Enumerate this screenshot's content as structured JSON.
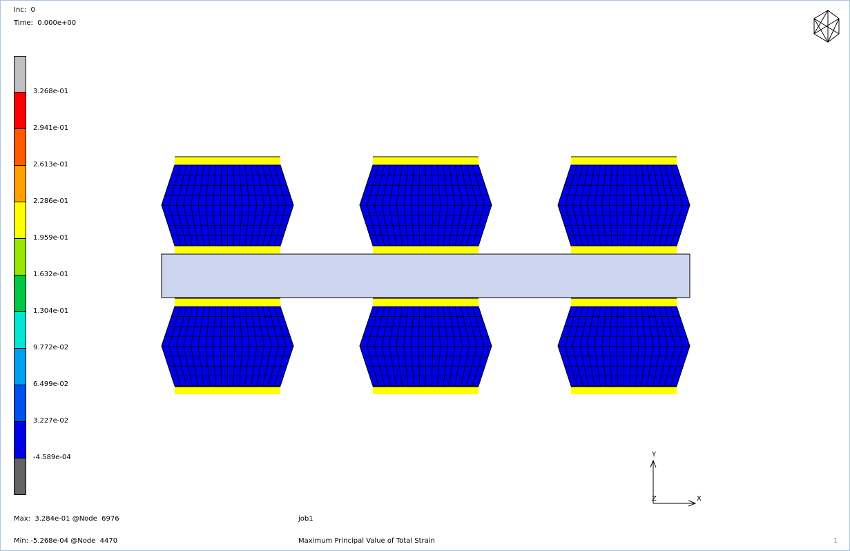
{
  "header": {
    "inc_label": "Inc:",
    "inc_value": "0",
    "time_label": "Time:",
    "time_value": "0.000e+00"
  },
  "legend": {
    "colors": [
      "#c0c0c0",
      "#ff0000",
      "#ff5a00",
      "#ffa000",
      "#ffff00",
      "#96e600",
      "#00c846",
      "#00e6d2",
      "#00a0f0",
      "#0050f0",
      "#0000e6",
      "#646464"
    ],
    "labels": [
      "3.268e-01",
      "2.941e-01",
      "2.613e-01",
      "2.286e-01",
      "1.959e-01",
      "1.632e-01",
      "1.304e-01",
      "9.772e-02",
      "6.499e-02",
      "3.227e-02",
      "-4.589e-04"
    ]
  },
  "footer": {
    "max_label": "Max:",
    "max_value": "3.284e-01 @Node  6976",
    "min_label": "Min:",
    "min_value": "-5.268e-04 @Node  4470",
    "job_name": "job1",
    "result_title": "Maximum Principal Value of Total Strain",
    "page_number": "1"
  },
  "axes": {
    "y": "Y",
    "z": "Z",
    "x": "X"
  },
  "icons": {
    "view_cube": "wireframe-cube-icon"
  },
  "colors": {
    "mesh_fill": "#0000e6",
    "pad_fill": "#ffff00",
    "plate_fill": "#cdd5ee",
    "frame": "#a9c3e0"
  }
}
